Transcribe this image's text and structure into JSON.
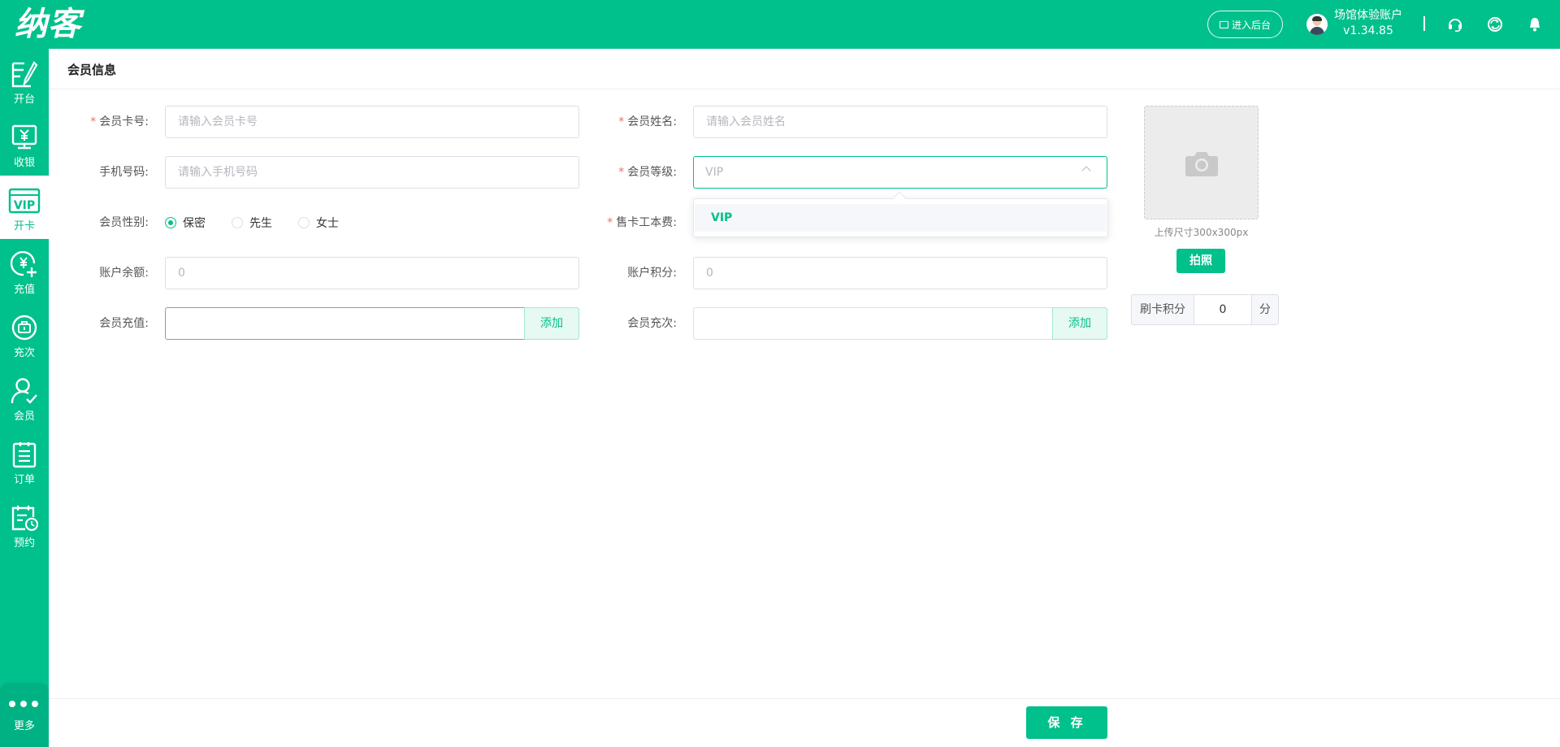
{
  "header": {
    "logo": "纳客",
    "backend_label": "进入后台",
    "account_name": "场馆体验账户",
    "version": "v1.34.85"
  },
  "sidebar": {
    "items": [
      {
        "label": "开台",
        "icon": "open-table-icon"
      },
      {
        "label": "收银",
        "icon": "cashier-icon"
      },
      {
        "label": "开卡",
        "icon": "vip-card-icon"
      },
      {
        "label": "充值",
        "icon": "recharge-icon"
      },
      {
        "label": "充次",
        "icon": "recharge-times-icon"
      },
      {
        "label": "会员",
        "icon": "member-icon"
      },
      {
        "label": "订单",
        "icon": "order-icon"
      },
      {
        "label": "预约",
        "icon": "reservation-icon"
      }
    ],
    "more_label": "更多"
  },
  "page": {
    "title": "会员信息"
  },
  "form": {
    "card_no": {
      "label": "会员卡号:",
      "placeholder": "请输入会员卡号",
      "required": true
    },
    "name": {
      "label": "会员姓名:",
      "placeholder": "请输入会员姓名",
      "required": true
    },
    "phone": {
      "label": "手机号码:",
      "placeholder": "请输入手机号码"
    },
    "level": {
      "label": "会员等级:",
      "value": "VIP",
      "required": true,
      "options": [
        "VIP"
      ]
    },
    "gender": {
      "label": "会员性别:",
      "options": [
        "保密",
        "先生",
        "女士"
      ],
      "selected": "保密"
    },
    "card_fee": {
      "label": "售卡工本费:",
      "required": true
    },
    "balance": {
      "label": "账户余额:",
      "placeholder": "0"
    },
    "points": {
      "label": "账户积分:",
      "placeholder": "0"
    },
    "recharge": {
      "label": "会员充值:",
      "button": "添加"
    },
    "recharge_times": {
      "label": "会员充次:",
      "button": "添加"
    }
  },
  "photo": {
    "hint": "上传尺寸300x300px",
    "button": "拍照"
  },
  "swipe_points": {
    "label": "刷卡积分",
    "value": "0",
    "unit": "分"
  },
  "footer": {
    "save_label": "保 存"
  },
  "colors": {
    "accent": "#00c08b",
    "required": "#f56c6c"
  }
}
